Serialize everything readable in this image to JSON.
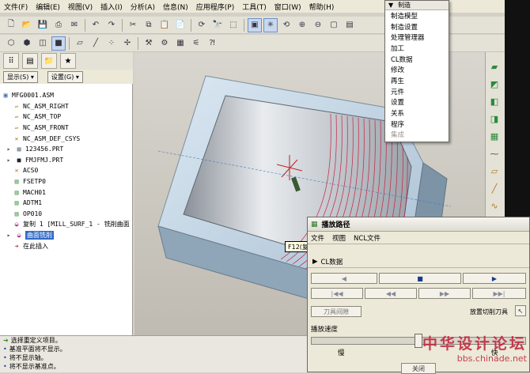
{
  "menubar": {
    "items": [
      "文件(F)",
      "编辑(E)",
      "视图(V)",
      "插入(I)",
      "分析(A)",
      "信息(N)",
      "应用程序(P)",
      "工具(T)",
      "窗口(W)",
      "帮助(H)"
    ]
  },
  "left_panel": {
    "show_button": "显示(S) ▾",
    "settings_button": "设置(G) ▾",
    "tree": [
      {
        "label": "MFG0001.ASM",
        "icon": "assembly-icon"
      },
      {
        "label": "NC_ASM_RIGHT",
        "icon": "datum-plane-icon"
      },
      {
        "label": "NC_ASM_TOP",
        "icon": "datum-plane-icon"
      },
      {
        "label": "NC_ASM_FRONT",
        "icon": "datum-plane-icon"
      },
      {
        "label": "NC_ASM_DEF_CSYS",
        "icon": "csys-icon"
      },
      {
        "label": "123456.PRT",
        "icon": "part-icon"
      },
      {
        "label": "FMJFMJ.PRT",
        "icon": "workpiece-icon"
      },
      {
        "label": "ACS0",
        "icon": "csys-icon"
      },
      {
        "label": "FSETP0",
        "icon": "fixture-icon"
      },
      {
        "label": "MACH01",
        "icon": "machine-icon"
      },
      {
        "label": "ADTM1",
        "icon": "datum-icon"
      },
      {
        "label": "OP010",
        "icon": "operation-icon"
      },
      {
        "label": "复制 1 [MILL_SURF_1 - 铣削曲面",
        "icon": "sequence-icon"
      },
      {
        "label": "曲面铣削",
        "icon": "surface-icon"
      },
      {
        "label": "在此插入",
        "icon": "insert-here-icon"
      }
    ]
  },
  "dropdown": {
    "header": "制造",
    "items": [
      "制造模型",
      "制造设置",
      "处理管理器",
      "加工",
      "CL数据",
      "修改",
      "再生",
      "元件",
      "设置",
      "关系",
      "程序",
      "集成"
    ],
    "disabled_index": 11
  },
  "tooltip": "F12(复制_1)",
  "dialog": {
    "title": "播放路径",
    "menu": [
      "文件",
      "视图",
      "NCL文件"
    ],
    "cl_section": "CL数据",
    "tool_clearance_button": "刀具间隙",
    "place_tool_label": "放置切削刀具",
    "speed_label": "播放速度",
    "slow_label": "慢",
    "fast_label": "快",
    "close_button": "关闭",
    "speed": 0.5
  },
  "messages": [
    "选择重定义项目。",
    "基准平面将不显示。",
    "将不显示轴。",
    "将不显示基准点。"
  ],
  "watermark": {
    "cn": "中华设计论坛",
    "url": "bbs.chinade.net"
  },
  "colors": {
    "selection": "#3168c4",
    "toolpath": "#c8203e",
    "workpiece": "#c3d6e6"
  }
}
